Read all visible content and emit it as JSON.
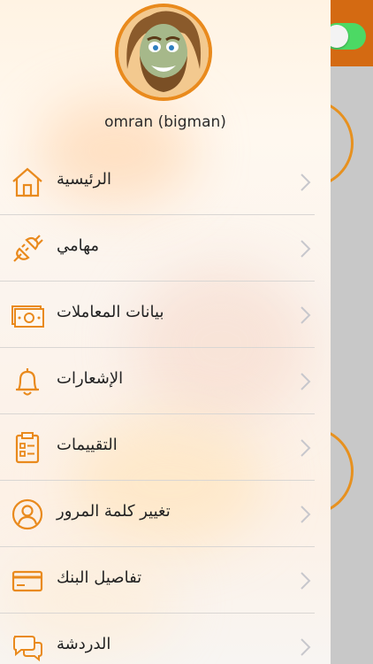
{
  "user": {
    "name": "omran (bigman)"
  },
  "menu": {
    "items": [
      {
        "label": "الرئيسية",
        "icon": "home-icon"
      },
      {
        "label": "مهامي",
        "icon": "plug-icon"
      },
      {
        "label": "بيانات المعاملات",
        "icon": "money-icon"
      },
      {
        "label": "الإشعارات",
        "icon": "bell-icon"
      },
      {
        "label": "التقييمات",
        "icon": "clipboard-icon"
      },
      {
        "label": "تغيير كلمة المرور",
        "icon": "user-icon"
      },
      {
        "label": "تفاصيل البنك",
        "icon": "credit-card-icon"
      },
      {
        "label": "الدردشة",
        "icon": "chat-icon"
      }
    ]
  },
  "colors": {
    "accent": "#e98a1d",
    "toggle_on": "#4cd964",
    "topbar": "#d46a12"
  }
}
